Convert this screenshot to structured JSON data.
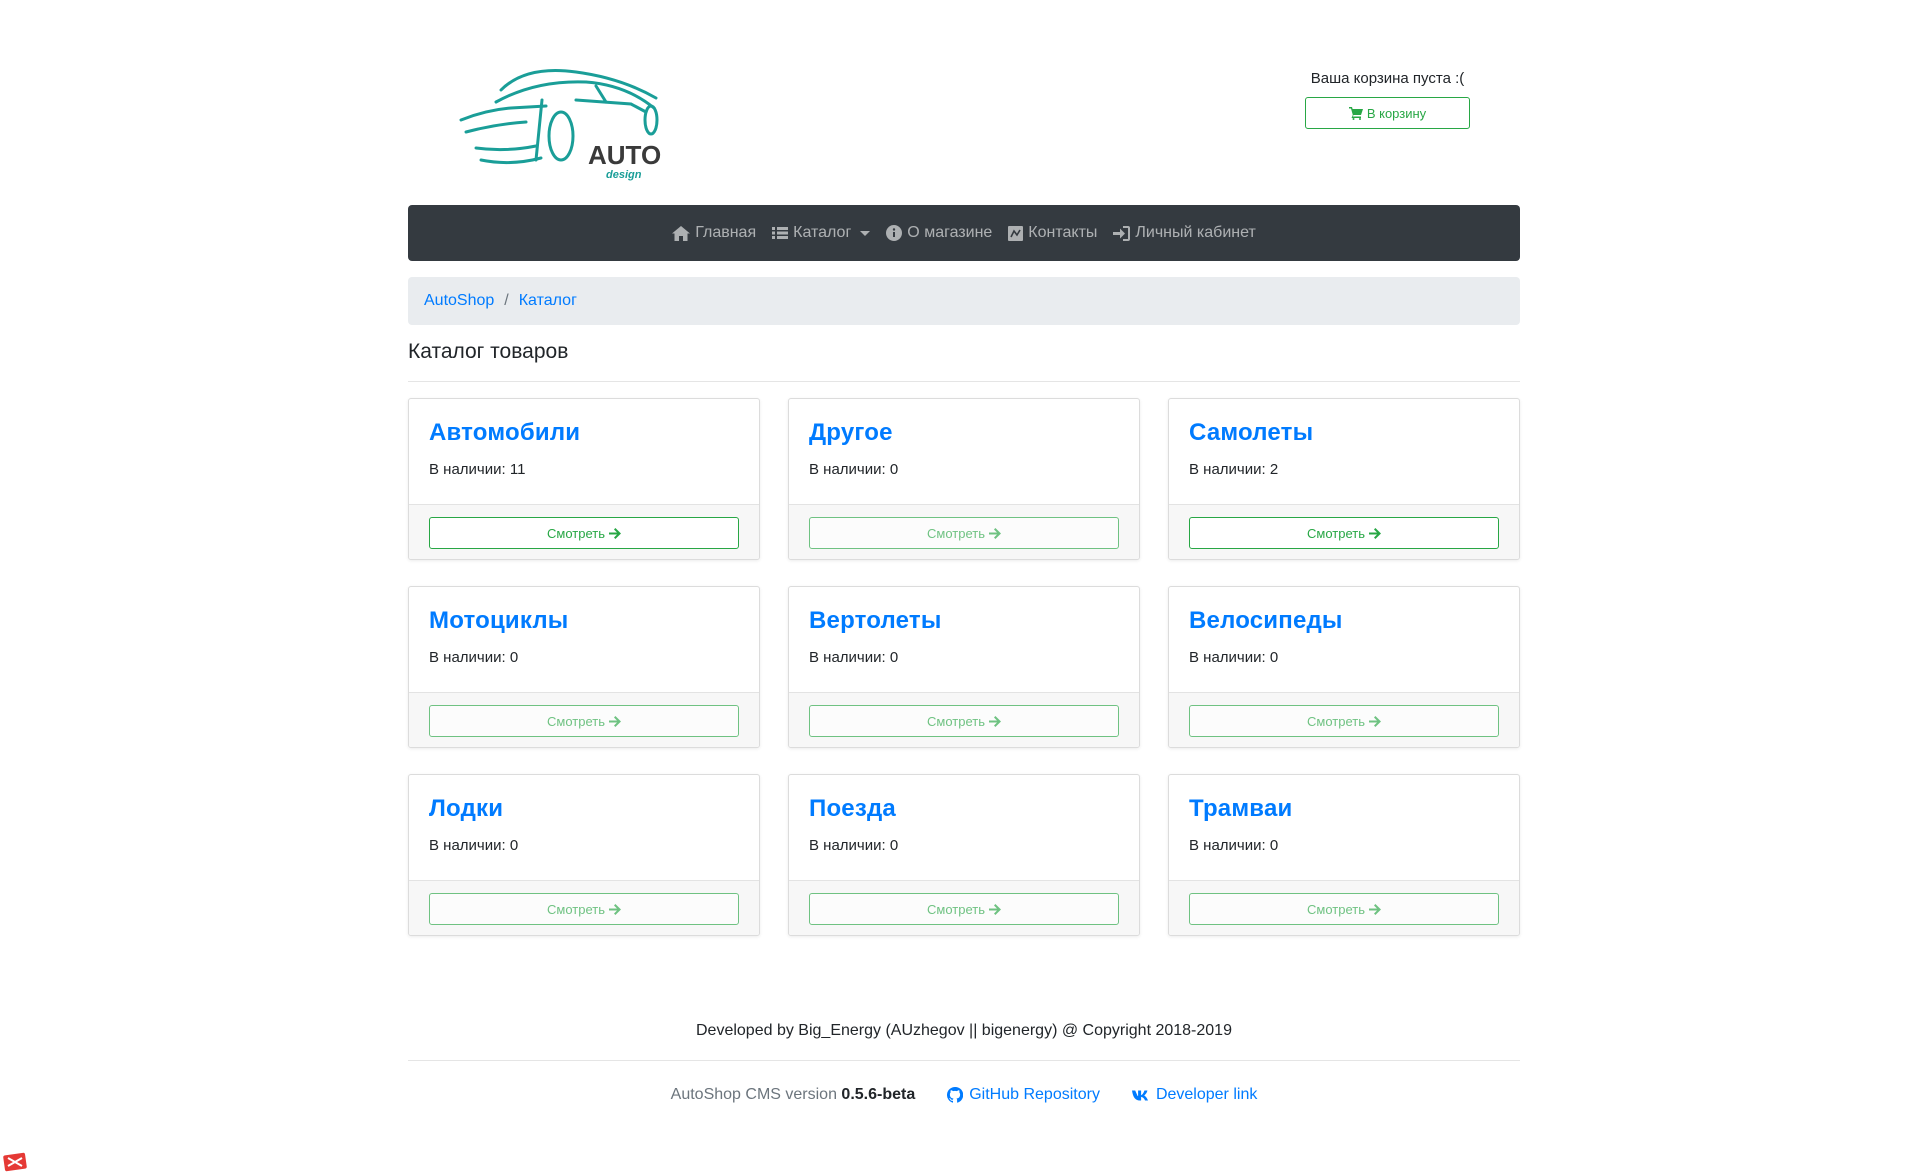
{
  "header": {
    "logo_text": "AUTO",
    "logo_subtext": "design",
    "cart_status": "Ваша корзина пуста :(",
    "cart_button": "В корзину"
  },
  "navbar": {
    "items": [
      {
        "label": "Главная",
        "icon": "home-icon"
      },
      {
        "label": "Каталог",
        "icon": "list-icon",
        "dropdown": true
      },
      {
        "label": "О магазине",
        "icon": "info-icon"
      },
      {
        "label": "Контакты",
        "icon": "contact-icon"
      },
      {
        "label": "Личный кабинет",
        "icon": "sign-in-icon"
      }
    ]
  },
  "breadcrumb": {
    "items": [
      "AutoShop",
      "Каталог"
    ],
    "separator": "/"
  },
  "page_title": "Каталог товаров",
  "stock_prefix": "В наличии: ",
  "view_label": "Смотреть",
  "categories": [
    {
      "title": "Автомобили",
      "stock": "В наличии: 11"
    },
    {
      "title": "Другое",
      "stock": "В наличии: 0"
    },
    {
      "title": "Самолеты",
      "stock": "В наличии: 2"
    },
    {
      "title": "Мотоциклы",
      "stock": "В наличии: 0"
    },
    {
      "title": "Вертолеты",
      "stock": "В наличии: 0"
    },
    {
      "title": "Велосипеды",
      "stock": "В наличии: 0"
    },
    {
      "title": "Лодки",
      "stock": "В наличии: 0"
    },
    {
      "title": "Поезда",
      "stock": "В наличии: 0"
    },
    {
      "title": "Трамваи",
      "stock": "В наличии: 0"
    }
  ],
  "footer": {
    "developed_by": "Developed by Big_Energy (AUzhegov || bigenergy) @ Copyright 2018-2019",
    "version_prefix": "AutoShop CMS version",
    "version": "0.5.6-beta",
    "github_link": "GitHub Repository",
    "developer_link": "Developer link"
  },
  "colors": {
    "accent": "#007bff",
    "success": "#28a745",
    "navbar": "#343a40",
    "logo": "#1a9e98"
  }
}
